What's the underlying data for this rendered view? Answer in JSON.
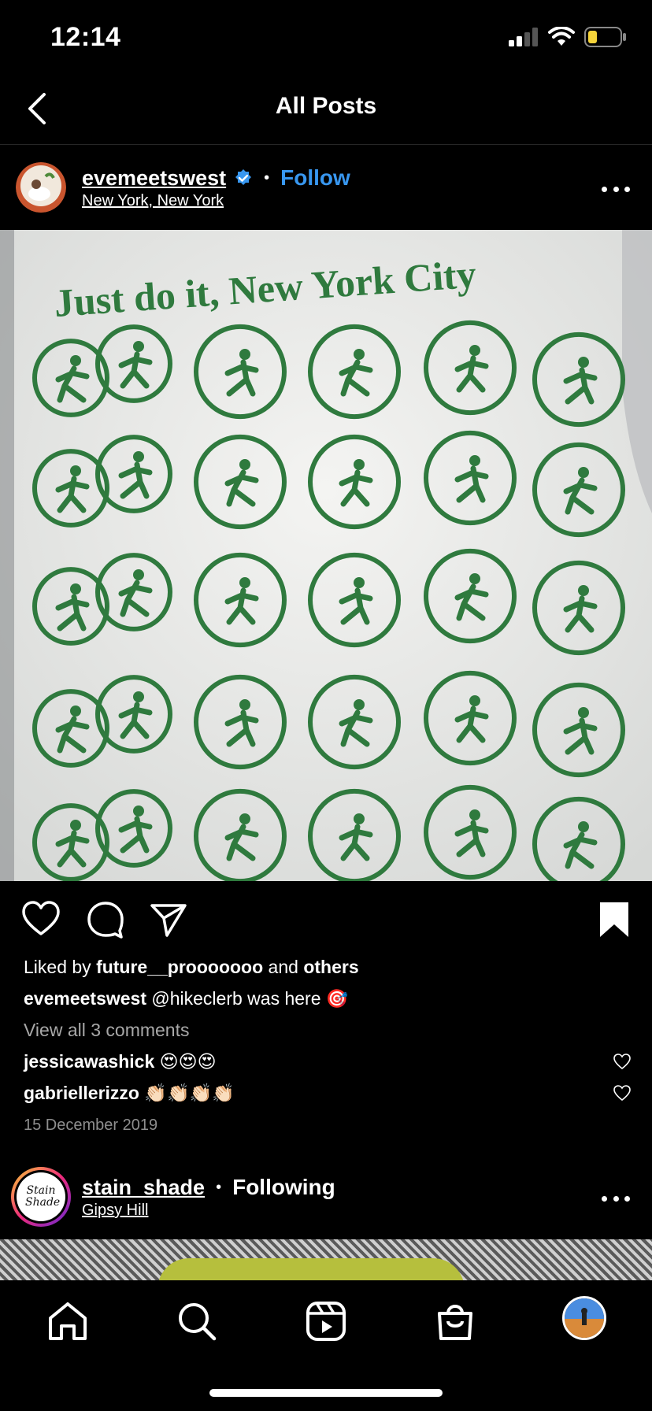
{
  "status": {
    "time": "12:14"
  },
  "header": {
    "title": "All Posts"
  },
  "post1": {
    "username": "evemeetswest",
    "follow_label": "Follow",
    "location": "New York, New York",
    "shirt_text": "Just do it, New York City",
    "liked_prefix": "Liked by",
    "liked_user": "future__prooooooo",
    "liked_and": "and",
    "liked_others": "others",
    "caption_user": "evemeetswest",
    "caption_text": "@hikeclerb was here 🎯",
    "view_comments": "View all 3 comments",
    "comments": [
      {
        "user": "jessicawashick",
        "text": "😍😍😍"
      },
      {
        "user": "gabriellerizzo",
        "text": "👏🏻👏🏻👏🏻👏🏻"
      }
    ],
    "date": "15 December 2019"
  },
  "post2": {
    "username": "stain_shade",
    "follow_label": "Following",
    "location": "Gipsy Hill",
    "avatar_text": "Stain Shade"
  },
  "icons": {
    "back": "chevron-left-icon",
    "like": "heart-icon",
    "comment": "comment-icon",
    "share": "paper-plane-icon",
    "save": "bookmark-icon",
    "more": "ellipsis-icon"
  },
  "colors": {
    "accent": "#3897f0",
    "verified": "#3897f0",
    "shirt_green": "#2f7a3e"
  },
  "tabs": [
    "home",
    "search",
    "reels",
    "shop",
    "profile"
  ]
}
